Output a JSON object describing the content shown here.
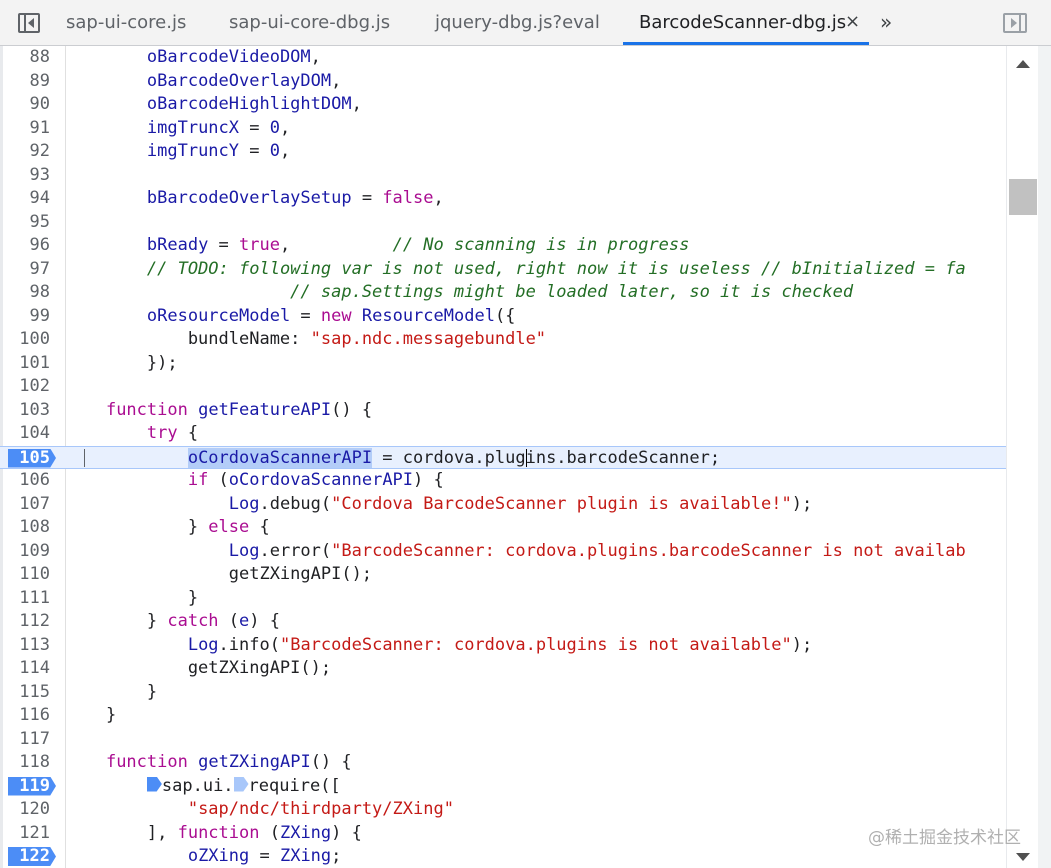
{
  "tabs": [
    {
      "label": "sap-ui-core.js",
      "active": false
    },
    {
      "label": "sap-ui-core-dbg.js",
      "active": false
    },
    {
      "label": "jquery-dbg.js?eval",
      "active": false
    },
    {
      "label": "BarcodeScanner-dbg.js",
      "active": true
    }
  ],
  "tab_close_glyph": "×",
  "tab_overflow_glyph": "»",
  "icons": {
    "navigator_toggle": "sidebar-left-icon",
    "debugger_toggle": "sidebar-right-icon",
    "scroll_up": "triangle-up-icon",
    "scroll_down": "triangle-down-icon"
  },
  "colors": {
    "accent": "#1a73e8",
    "breakpoint": "#4c8df6",
    "current_line": "#e8f0fe",
    "keyword": "#aa0d91",
    "string": "#c41a16",
    "comment": "#236e25",
    "variable": "#1a1aa6"
  },
  "editor": {
    "current_line": 105,
    "breakpoints": [
      105,
      119,
      122
    ],
    "lines": [
      {
        "n": "88",
        "tokens": [
          [
            "",
            "        "
          ],
          [
            "v",
            "oBarcodeVideoDOM"
          ],
          [
            "",
            ","
          ]
        ]
      },
      {
        "n": "89",
        "tokens": [
          [
            "",
            "        "
          ],
          [
            "v",
            "oBarcodeOverlayDOM"
          ],
          [
            "",
            ","
          ]
        ]
      },
      {
        "n": "90",
        "tokens": [
          [
            "",
            "        "
          ],
          [
            "v",
            "oBarcodeHighlightDOM"
          ],
          [
            "",
            ","
          ]
        ]
      },
      {
        "n": "91",
        "tokens": [
          [
            "",
            "        "
          ],
          [
            "v",
            "imgTruncX"
          ],
          [
            "",
            " = "
          ],
          [
            "v",
            "0"
          ],
          [
            "",
            ","
          ]
        ]
      },
      {
        "n": "92",
        "tokens": [
          [
            "",
            "        "
          ],
          [
            "v",
            "imgTruncY"
          ],
          [
            "",
            " = "
          ],
          [
            "v",
            "0"
          ],
          [
            "",
            ","
          ]
        ]
      },
      {
        "n": "93",
        "tokens": []
      },
      {
        "n": "94",
        "tokens": [
          [
            "",
            "        "
          ],
          [
            "v",
            "bBarcodeOverlaySetup"
          ],
          [
            "",
            " = "
          ],
          [
            "k",
            "false"
          ],
          [
            "",
            ","
          ]
        ]
      },
      {
        "n": "95",
        "tokens": []
      },
      {
        "n": "96",
        "tokens": [
          [
            "",
            "        "
          ],
          [
            "v",
            "bReady"
          ],
          [
            "",
            " = "
          ],
          [
            "k",
            "true"
          ],
          [
            "",
            ",          "
          ],
          [
            "c",
            "// No scanning is in progress"
          ]
        ]
      },
      {
        "n": "97",
        "tokens": [
          [
            "",
            "        "
          ],
          [
            "c",
            "// TODO: following var is not used, right now it is useless // bInitialized = fa"
          ]
        ]
      },
      {
        "n": "98",
        "tokens": [
          [
            "",
            "                      "
          ],
          [
            "c",
            "// sap.Settings might be loaded later, so it is checked"
          ]
        ]
      },
      {
        "n": "99",
        "tokens": [
          [
            "",
            "        "
          ],
          [
            "v",
            "oResourceModel"
          ],
          [
            "",
            " = "
          ],
          [
            "k",
            "new"
          ],
          [
            "",
            " "
          ],
          [
            "v",
            "ResourceModel"
          ],
          [
            "",
            "({"
          ]
        ]
      },
      {
        "n": "100",
        "tokens": [
          [
            "",
            "            bundleName: "
          ],
          [
            "s",
            "\"sap.ndc.messagebundle\""
          ]
        ]
      },
      {
        "n": "101",
        "tokens": [
          [
            "",
            "        });"
          ]
        ]
      },
      {
        "n": "102",
        "tokens": []
      },
      {
        "n": "103",
        "tokens": [
          [
            "",
            "    "
          ],
          [
            "k",
            "function"
          ],
          [
            "",
            " "
          ],
          [
            "d",
            "getFeatureAPI"
          ],
          [
            "",
            "() {"
          ]
        ]
      },
      {
        "n": "104",
        "tokens": [
          [
            "",
            "        "
          ],
          [
            "k",
            "try"
          ],
          [
            "",
            " {"
          ]
        ]
      },
      {
        "n": "105",
        "tokens": [
          [
            "",
            "            "
          ],
          [
            "sel",
            "oCordovaScannerAPI"
          ],
          [
            "",
            " = cordova.plug"
          ],
          [
            "caret",
            ""
          ],
          [
            "",
            "ins.barcodeScanner;"
          ]
        ]
      },
      {
        "n": "106",
        "tokens": [
          [
            "",
            "            "
          ],
          [
            "k",
            "if"
          ],
          [
            "",
            " ("
          ],
          [
            "v",
            "oCordovaScannerAPI"
          ],
          [
            "",
            ") {"
          ]
        ]
      },
      {
        "n": "107",
        "tokens": [
          [
            "",
            "                "
          ],
          [
            "v",
            "Log"
          ],
          [
            "",
            ".debug("
          ],
          [
            "s",
            "\"Cordova BarcodeScanner plugin is available!\""
          ],
          [
            "",
            ");"
          ]
        ]
      },
      {
        "n": "108",
        "tokens": [
          [
            "",
            "            } "
          ],
          [
            "k",
            "else"
          ],
          [
            "",
            " {"
          ]
        ]
      },
      {
        "n": "109",
        "tokens": [
          [
            "",
            "                "
          ],
          [
            "v",
            "Log"
          ],
          [
            "",
            ".error("
          ],
          [
            "s",
            "\"BarcodeScanner: cordova.plugins.barcodeScanner is not availab"
          ]
        ]
      },
      {
        "n": "110",
        "tokens": [
          [
            "",
            "                getZXingAPI();"
          ]
        ]
      },
      {
        "n": "111",
        "tokens": [
          [
            "",
            "            }"
          ]
        ]
      },
      {
        "n": "112",
        "tokens": [
          [
            "",
            "        } "
          ],
          [
            "k",
            "catch"
          ],
          [
            "",
            " ("
          ],
          [
            "v",
            "e"
          ],
          [
            "",
            ") {"
          ]
        ]
      },
      {
        "n": "113",
        "tokens": [
          [
            "",
            "            "
          ],
          [
            "v",
            "Log"
          ],
          [
            "",
            ".info("
          ],
          [
            "s",
            "\"BarcodeScanner: cordova.plugins is not available\""
          ],
          [
            "",
            ");"
          ]
        ]
      },
      {
        "n": "114",
        "tokens": [
          [
            "",
            "            getZXingAPI();"
          ]
        ]
      },
      {
        "n": "115",
        "tokens": [
          [
            "",
            "        }"
          ]
        ]
      },
      {
        "n": "116",
        "tokens": [
          [
            "",
            "    }"
          ]
        ]
      },
      {
        "n": "117",
        "tokens": []
      },
      {
        "n": "118",
        "tokens": [
          [
            "",
            "    "
          ],
          [
            "k",
            "function"
          ],
          [
            "",
            " "
          ],
          [
            "d",
            "getZXingAPI"
          ],
          [
            "",
            "() {"
          ]
        ]
      },
      {
        "n": "119",
        "tokens": [
          [
            "",
            "        "
          ],
          [
            "bp",
            ""
          ],
          [
            "",
            "sap.ui."
          ],
          [
            "bpp",
            ""
          ],
          [
            "",
            "require(["
          ]
        ]
      },
      {
        "n": "120",
        "tokens": [
          [
            "",
            "            "
          ],
          [
            "s",
            "\"sap/ndc/thirdparty/ZXing\""
          ]
        ]
      },
      {
        "n": "121",
        "tokens": [
          [
            "",
            "        ], "
          ],
          [
            "k",
            "function"
          ],
          [
            "",
            " ("
          ],
          [
            "v",
            "ZXing"
          ],
          [
            "",
            ") {"
          ]
        ]
      },
      {
        "n": "122",
        "tokens": [
          [
            "",
            "            "
          ],
          [
            "v",
            "oZXing"
          ],
          [
            "",
            " = "
          ],
          [
            "v",
            "ZXing"
          ],
          [
            "",
            ";"
          ]
        ]
      }
    ]
  },
  "watermark": "@稀土掘金技术社区"
}
